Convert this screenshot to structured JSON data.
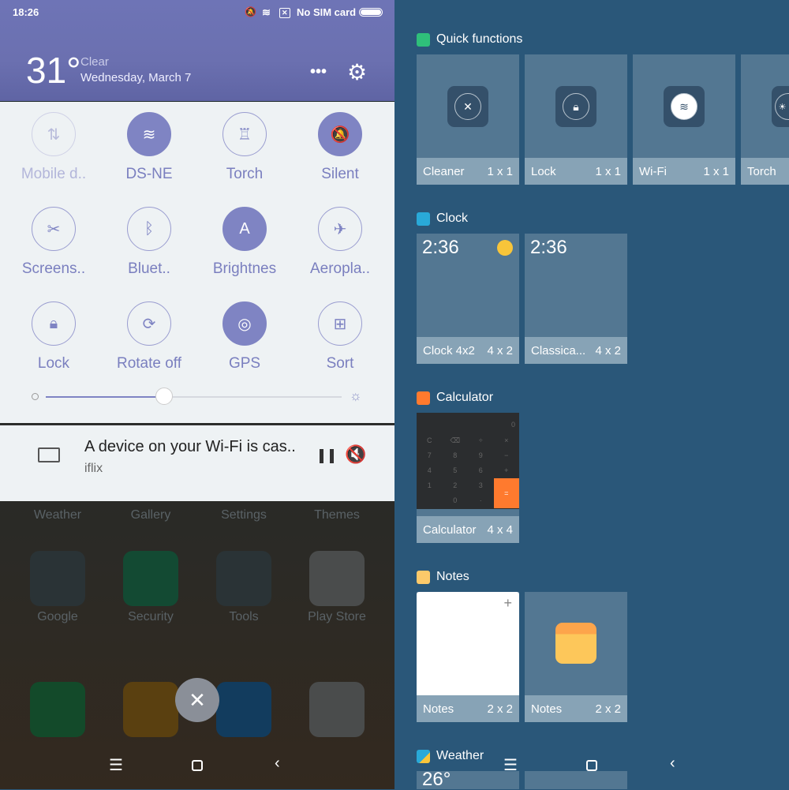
{
  "status": {
    "time": "18:26",
    "sim": "No SIM card"
  },
  "weather_header": {
    "temp": "31°",
    "condition": "Clear",
    "date": "Wednesday, March 7"
  },
  "toggles": [
    {
      "label": "Mobile d..",
      "icon": "mobile-data-icon",
      "state": "disabled"
    },
    {
      "label": "DS-NE",
      "icon": "wifi-icon",
      "state": "on"
    },
    {
      "label": "Torch",
      "icon": "torch-icon",
      "state": "off"
    },
    {
      "label": "Silent",
      "icon": "silent-icon",
      "state": "on"
    },
    {
      "label": "Screens..",
      "icon": "screenshot-icon",
      "state": "off"
    },
    {
      "label": "Bluet..",
      "icon": "bluetooth-icon",
      "state": "off"
    },
    {
      "label": "Brightnes",
      "icon": "auto-brightness-icon",
      "state": "on"
    },
    {
      "label": "Aeropla..",
      "icon": "airplane-icon",
      "state": "off"
    },
    {
      "label": "Lock",
      "icon": "lock-icon",
      "state": "off"
    },
    {
      "label": "Rotate off",
      "icon": "rotate-icon",
      "state": "off"
    },
    {
      "label": "GPS",
      "icon": "gps-icon",
      "state": "on"
    },
    {
      "label": "Sort",
      "icon": "grid-icon",
      "state": "off"
    }
  ],
  "brightness": 0.4,
  "notification": {
    "title": "A device on your Wi-Fi is cas..",
    "app": "iflix"
  },
  "home_apps": {
    "row1": [
      "Weather",
      "Gallery",
      "Settings",
      "Themes"
    ],
    "row2": [
      "Google",
      "Security",
      "Tools",
      "Play Store"
    ]
  },
  "widgets": {
    "quick": {
      "title": "Quick functions",
      "tiles": [
        {
          "name": "Cleaner",
          "size": "1 x 1"
        },
        {
          "name": "Lock",
          "size": "1 x 1"
        },
        {
          "name": "Wi-Fi",
          "size": "1 x 1"
        },
        {
          "name": "Torch",
          "size": ""
        }
      ]
    },
    "clock": {
      "title": "Clock",
      "time": "2:36",
      "tiles": [
        {
          "name": "Clock 4x2",
          "size": "4 x 2"
        },
        {
          "name": "Classica...",
          "size": "4 x 2"
        }
      ]
    },
    "calculator": {
      "title": "Calculator",
      "display": "0",
      "keys": [
        "C",
        "⌫",
        "÷",
        "×",
        "7",
        "8",
        "9",
        "−",
        "4",
        "5",
        "6",
        "+",
        "1",
        "2",
        "3",
        "=",
        "",
        "0",
        "·",
        ""
      ],
      "tiles": [
        {
          "name": "Calculator",
          "size": "4 x 4"
        }
      ]
    },
    "notes": {
      "title": "Notes",
      "tiles": [
        {
          "name": "Notes",
          "size": "2 x 2"
        },
        {
          "name": "Notes",
          "size": "2 x 2"
        }
      ]
    },
    "weather": {
      "title": "Weather",
      "temp": "26°"
    }
  },
  "colors": {
    "accent": "#7f84c3",
    "header": "#6b70b0",
    "widget_bg": "#2a5779",
    "calc_orange": "#ff7a2e"
  }
}
